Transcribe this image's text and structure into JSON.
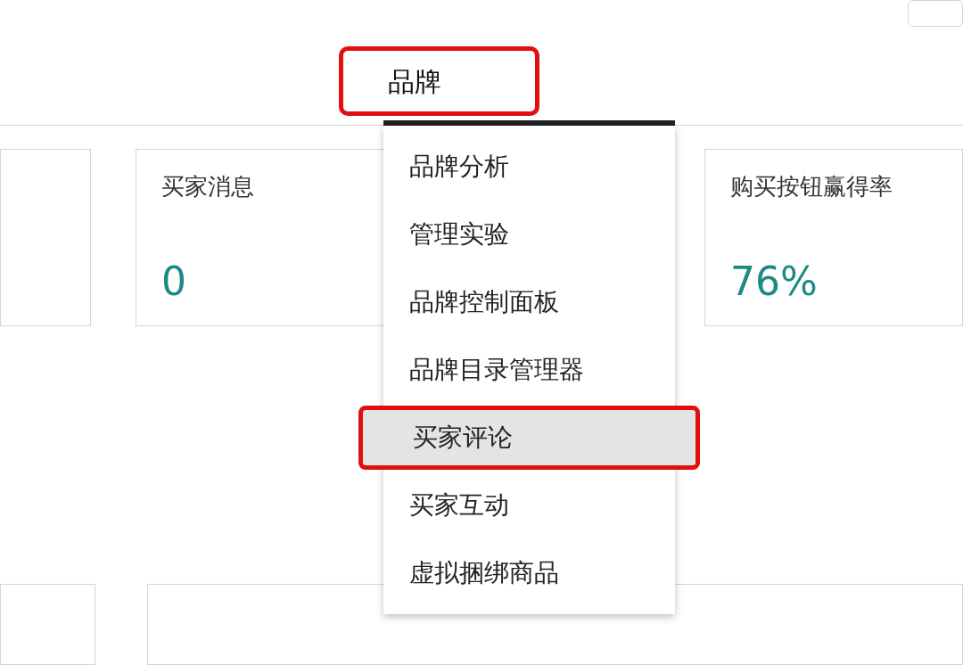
{
  "nav_tabs": [
    {
      "label": "品牌",
      "selected": true,
      "highlighted": true
    }
  ],
  "metric_cards": [
    {
      "title": "买家消息",
      "value": "0"
    },
    {
      "title": "购买按钮赢得率",
      "value": "76%"
    }
  ],
  "dropdown_menu": {
    "items": [
      {
        "label": "品牌分析",
        "selected": false,
        "highlighted": false
      },
      {
        "label": "管理实验",
        "selected": false,
        "highlighted": false
      },
      {
        "label": "品牌控制面板",
        "selected": false,
        "highlighted": false
      },
      {
        "label": "品牌目录管理器",
        "selected": false,
        "highlighted": false
      },
      {
        "label": "买家评论",
        "selected": true,
        "highlighted": true
      },
      {
        "label": "买家互动",
        "selected": false,
        "highlighted": false
      },
      {
        "label": "虚拟捆绑商品",
        "selected": false,
        "highlighted": false
      }
    ]
  }
}
